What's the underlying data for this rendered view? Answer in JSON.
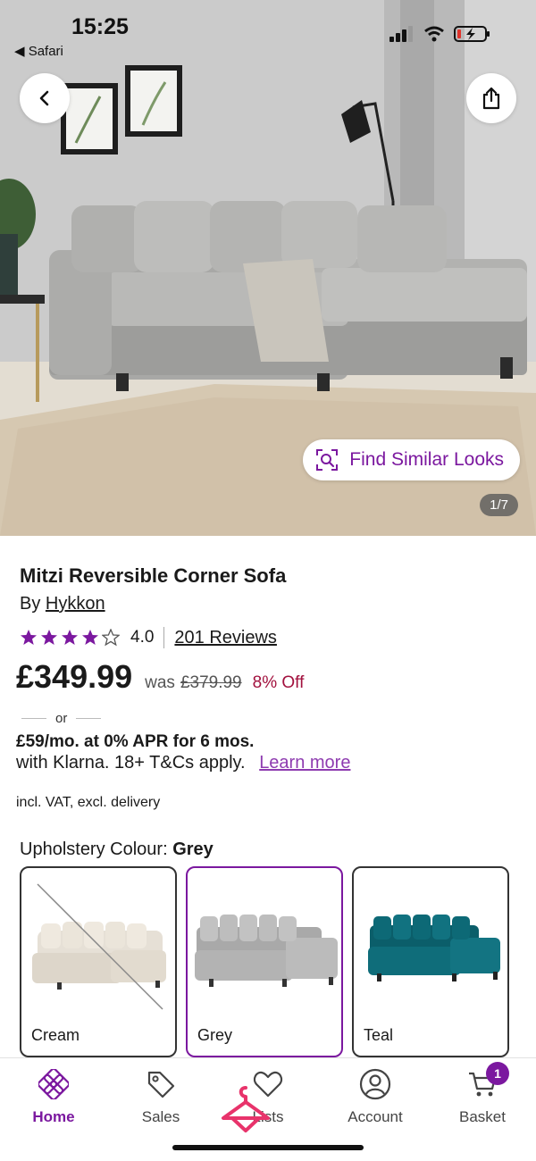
{
  "status_bar": {
    "time": "15:25",
    "back_app": "◀ Safari"
  },
  "hero": {
    "find_similar_label": "Find Similar Looks",
    "image_counter": "1/7"
  },
  "product": {
    "title": "Mitzi Reversible Corner Sofa",
    "by_prefix": "By",
    "brand": "Hykkon",
    "rating_value": "4.0",
    "rating_stars": 4,
    "rating_max": 5,
    "reviews_label": "201 Reviews",
    "price": "£349.99",
    "was_label": "was",
    "was_price": "£379.99",
    "discount": "8% Off",
    "or_label": "or",
    "klarna_line1": "£59/mo. at 0% APR for 6 mos.",
    "klarna_line2": "with Klarna. 18+ T&Cs apply.",
    "learn_more": "Learn more",
    "vat_note": "incl. VAT, excl. delivery"
  },
  "colour_selector": {
    "label": "Upholstery Colour:",
    "selected": "Grey",
    "options": [
      {
        "name": "Cream",
        "available": false,
        "color": "#ece6dc"
      },
      {
        "name": "Grey",
        "available": true,
        "color": "#c4c4c4"
      },
      {
        "name": "Teal",
        "available": true,
        "color": "#0f6d7a"
      }
    ]
  },
  "tab_bar": {
    "tabs": [
      {
        "label": "Home",
        "active": true
      },
      {
        "label": "Sales",
        "active": false
      },
      {
        "label": "Lists",
        "active": false
      },
      {
        "label": "Account",
        "active": false
      },
      {
        "label": "Basket",
        "active": false
      }
    ],
    "basket_count": "1"
  },
  "colors": {
    "accent": "#7b189f",
    "discount": "#a2113e",
    "hanger": "#e8336b"
  }
}
